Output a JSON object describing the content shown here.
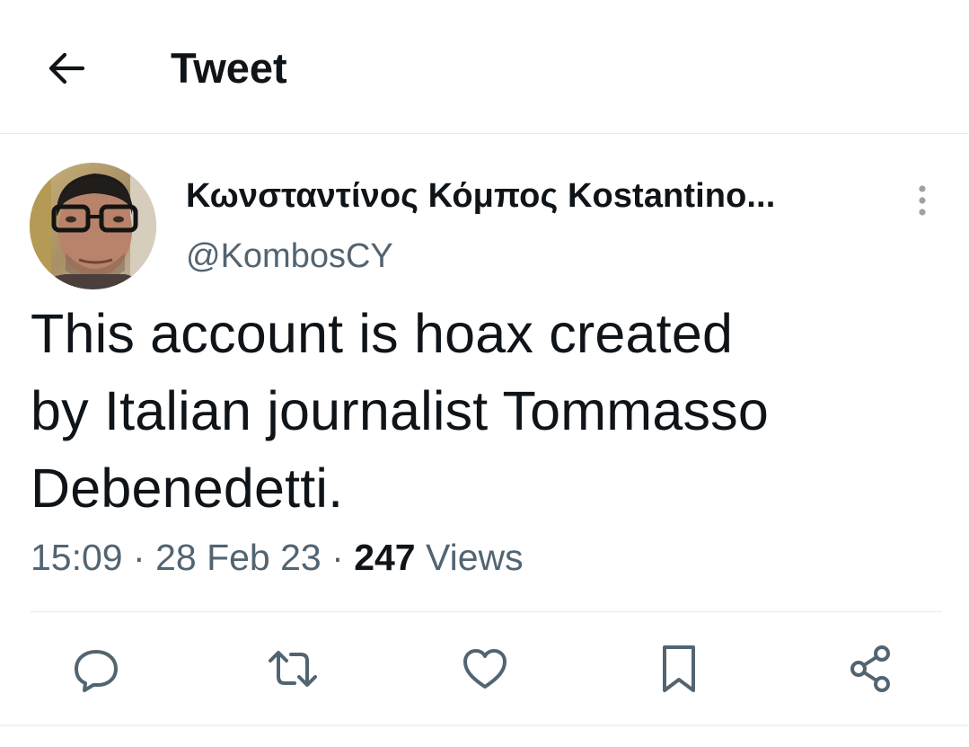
{
  "header": {
    "title": "Tweet",
    "back_icon": "arrow-left-icon"
  },
  "author": {
    "display_name": "Κωνσταντίνος Κόμπος Kostantino...",
    "handle": "@KombosCY",
    "avatar_icon": "profile-photo"
  },
  "tweet": {
    "text_lines": [
      "This account is hoax created",
      "by Italian journalist Tommasso",
      "Debenedetti."
    ],
    "time": "15:09",
    "separator": "·",
    "date": "28 Feb 23",
    "views_count": "247",
    "views_label": "Views"
  },
  "actions": [
    {
      "name": "reply",
      "icon": "reply-icon"
    },
    {
      "name": "retweet",
      "icon": "retweet-icon"
    },
    {
      "name": "like",
      "icon": "heart-icon"
    },
    {
      "name": "bookmark",
      "icon": "bookmark-icon"
    },
    {
      "name": "share",
      "icon": "share-icon"
    }
  ],
  "colors": {
    "text_primary": "#0f1419",
    "text_secondary": "#536471",
    "divider": "#e7e9ea",
    "background": "#ffffff"
  }
}
